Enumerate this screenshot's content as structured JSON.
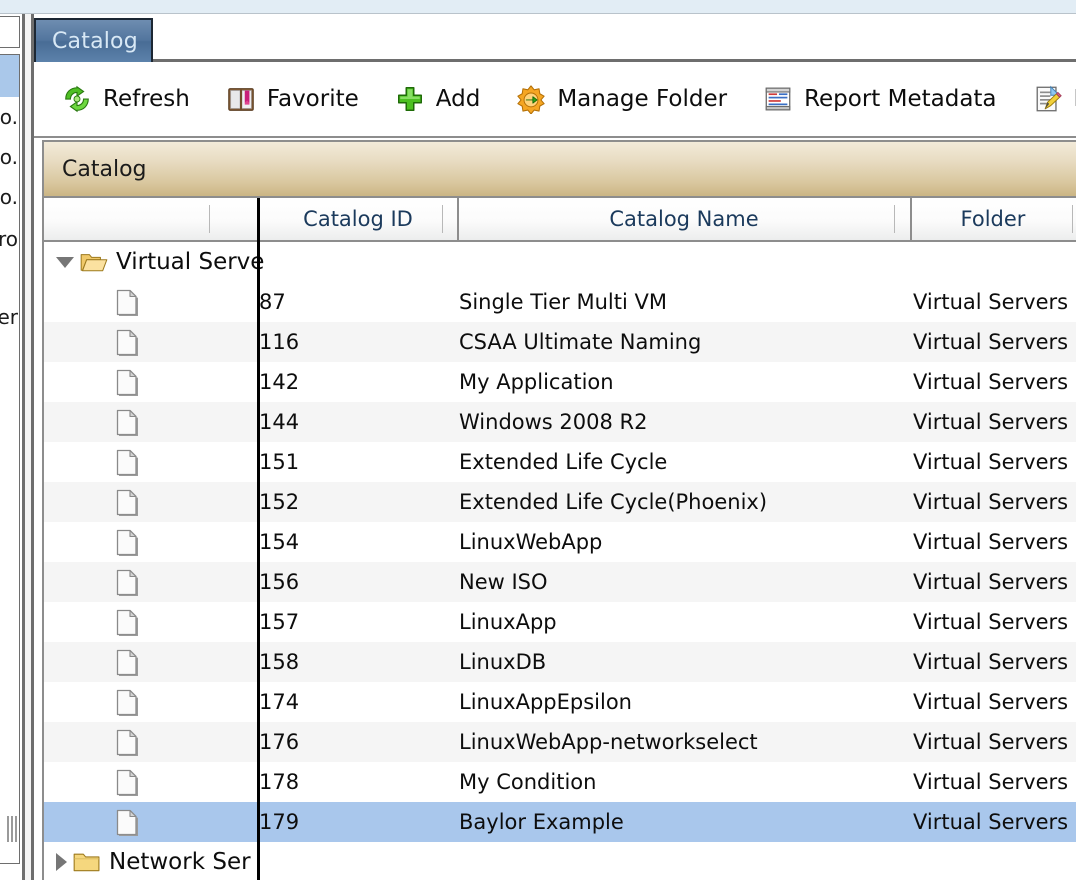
{
  "window": {
    "top_strip_color": "#e2edf5"
  },
  "left_panel": {
    "truncated_items": [
      "o.",
      "o.",
      "o.",
      "ro",
      "er"
    ],
    "selected_color": "#aac8ea",
    "splitter_name": "panel-splitter"
  },
  "tabs": [
    {
      "label": "Catalog",
      "active": true
    }
  ],
  "toolbar": {
    "items": [
      {
        "label": "Refresh",
        "icon": "refresh-icon"
      },
      {
        "label": "Favorite",
        "icon": "favorite-book-icon"
      },
      {
        "label": "Add",
        "icon": "add-plus-icon"
      },
      {
        "label": "Manage Folder",
        "icon": "manage-folder-icon"
      },
      {
        "label": "Report Metadata",
        "icon": "report-metadata-icon"
      },
      {
        "label": "E",
        "icon": "edit-document-icon"
      }
    ]
  },
  "grid": {
    "title": "Catalog",
    "title_gradient_start": "#f2ead9",
    "title_gradient_end": "#cbb584",
    "columns": [
      {
        "label": "",
        "key": "tree"
      },
      {
        "label": "Catalog ID",
        "key": "id"
      },
      {
        "label": "Catalog Name",
        "key": "name"
      },
      {
        "label": "Folder",
        "key": "folder"
      }
    ],
    "selection_color": "#a9c7ec",
    "rows": [
      {
        "type": "group",
        "expanded": true,
        "label": "Virtual Serve",
        "icon": "folder-open-icon"
      },
      {
        "type": "item",
        "id": "87",
        "name": "Single Tier Multi VM",
        "folder": "Virtual Servers"
      },
      {
        "type": "item",
        "id": "116",
        "name": "CSAA Ultimate Naming",
        "folder": "Virtual Servers"
      },
      {
        "type": "item",
        "id": "142",
        "name": "My Application",
        "folder": "Virtual Servers"
      },
      {
        "type": "item",
        "id": "144",
        "name": "Windows 2008 R2",
        "folder": "Virtual Servers"
      },
      {
        "type": "item",
        "id": "151",
        "name": "Extended Life Cycle",
        "folder": "Virtual Servers"
      },
      {
        "type": "item",
        "id": "152",
        "name": "Extended Life Cycle(Phoenix)",
        "folder": "Virtual Servers"
      },
      {
        "type": "item",
        "id": "154",
        "name": "LinuxWebApp",
        "folder": "Virtual Servers"
      },
      {
        "type": "item",
        "id": "156",
        "name": "New ISO",
        "folder": "Virtual Servers"
      },
      {
        "type": "item",
        "id": "157",
        "name": "LinuxApp",
        "folder": "Virtual Servers"
      },
      {
        "type": "item",
        "id": "158",
        "name": "LinuxDB",
        "folder": "Virtual Servers"
      },
      {
        "type": "item",
        "id": "174",
        "name": "LinuxAppEpsilon",
        "folder": "Virtual Servers"
      },
      {
        "type": "item",
        "id": "176",
        "name": "LinuxWebApp-networkselect",
        "folder": "Virtual Servers"
      },
      {
        "type": "item",
        "id": "178",
        "name": "My Condition",
        "folder": "Virtual Servers"
      },
      {
        "type": "item",
        "id": "179",
        "name": "Baylor Example",
        "folder": "Virtual Servers",
        "selected": true
      },
      {
        "type": "group",
        "expanded": false,
        "label": "Network Ser",
        "icon": "folder-closed-icon"
      }
    ]
  }
}
